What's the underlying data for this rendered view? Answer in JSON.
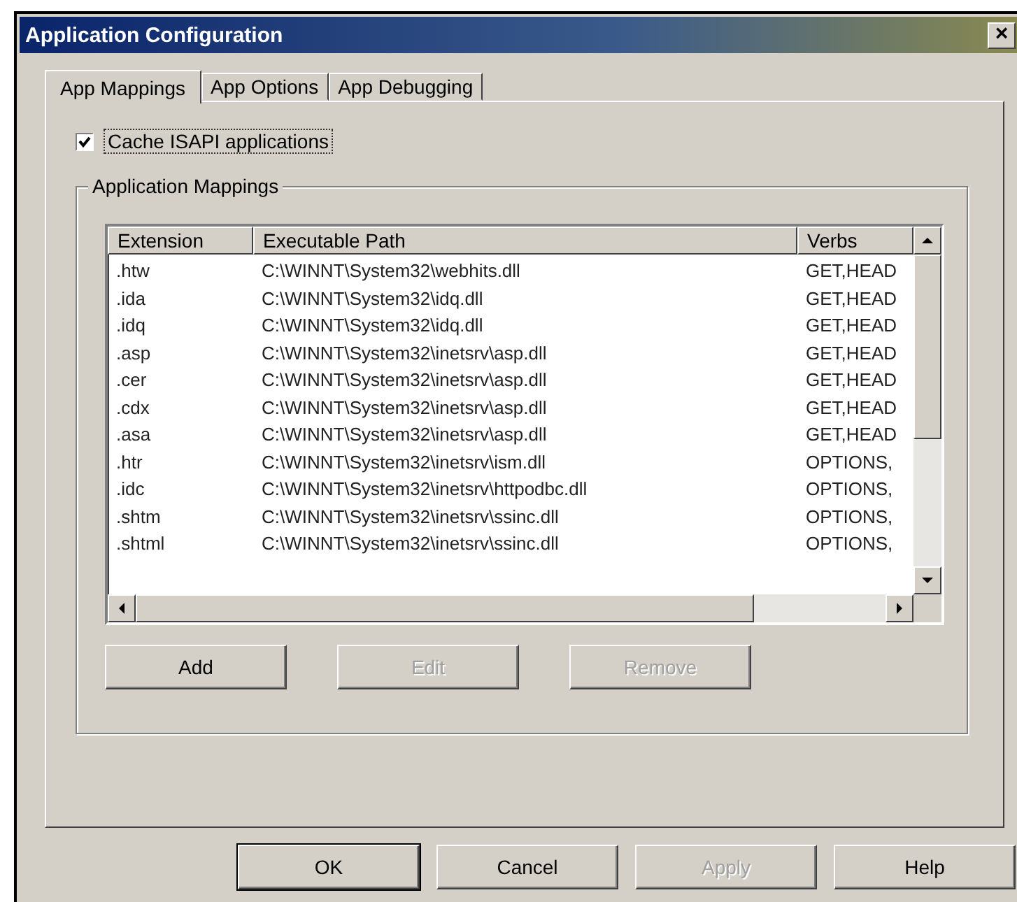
{
  "window": {
    "title": "Application Configuration",
    "close": "×"
  },
  "tabs": [
    {
      "label": "App Mappings",
      "selected": true
    },
    {
      "label": "App Options",
      "selected": false
    },
    {
      "label": "App Debugging",
      "selected": false
    }
  ],
  "cache_checkbox": {
    "label": "Cache ISAPI applications",
    "checked": true
  },
  "group": {
    "title": "Application Mappings"
  },
  "table": {
    "columns": [
      "Extension",
      "Executable Path",
      "Verbs"
    ],
    "rows": [
      {
        "extension": ".htw",
        "path": "C:\\WINNT\\System32\\webhits.dll",
        "verbs": "GET,HEAD"
      },
      {
        "extension": ".ida",
        "path": "C:\\WINNT\\System32\\idq.dll",
        "verbs": "GET,HEAD"
      },
      {
        "extension": ".idq",
        "path": "C:\\WINNT\\System32\\idq.dll",
        "verbs": "GET,HEAD"
      },
      {
        "extension": ".asp",
        "path": "C:\\WINNT\\System32\\inetsrv\\asp.dll",
        "verbs": "GET,HEAD"
      },
      {
        "extension": ".cer",
        "path": "C:\\WINNT\\System32\\inetsrv\\asp.dll",
        "verbs": "GET,HEAD"
      },
      {
        "extension": ".cdx",
        "path": "C:\\WINNT\\System32\\inetsrv\\asp.dll",
        "verbs": "GET,HEAD"
      },
      {
        "extension": ".asa",
        "path": "C:\\WINNT\\System32\\inetsrv\\asp.dll",
        "verbs": "GET,HEAD"
      },
      {
        "extension": ".htr",
        "path": "C:\\WINNT\\System32\\inetsrv\\ism.dll",
        "verbs": "OPTIONS,"
      },
      {
        "extension": ".idc",
        "path": "C:\\WINNT\\System32\\inetsrv\\httpodbc.dll",
        "verbs": "OPTIONS,"
      },
      {
        "extension": ".shtm",
        "path": "C:\\WINNT\\System32\\inetsrv\\ssinc.dll",
        "verbs": "OPTIONS,"
      },
      {
        "extension": ".shtml",
        "path": "C:\\WINNT\\System32\\inetsrv\\ssinc.dll",
        "verbs": "OPTIONS,"
      }
    ]
  },
  "list_buttons": [
    {
      "label": "Add",
      "disabled": false
    },
    {
      "label": "Edit",
      "disabled": true
    },
    {
      "label": "Remove",
      "disabled": true
    }
  ],
  "dialog_buttons": [
    {
      "label": "OK",
      "disabled": false,
      "default": true
    },
    {
      "label": "Cancel",
      "disabled": false,
      "default": false
    },
    {
      "label": "Apply",
      "disabled": true,
      "default": false
    },
    {
      "label": "Help",
      "disabled": false,
      "default": false
    }
  ]
}
